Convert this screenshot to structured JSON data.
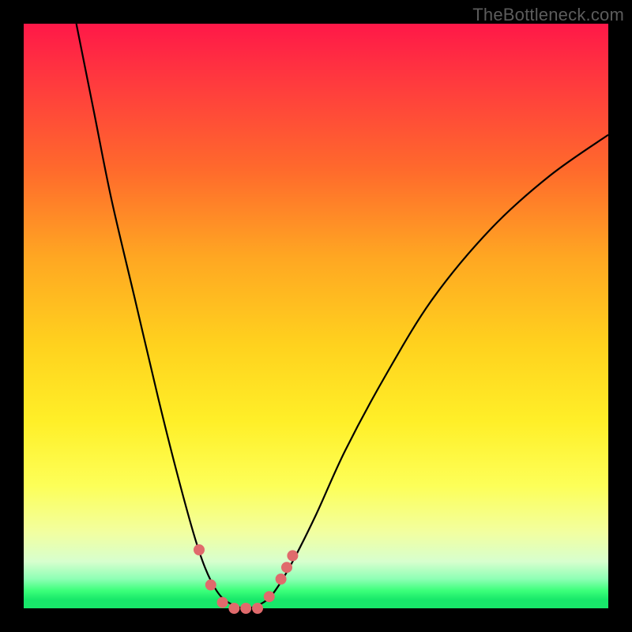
{
  "watermark": "TheBottleneck.com",
  "chart_data": {
    "type": "line",
    "title": "",
    "xlabel": "",
    "ylabel": "",
    "xlim": [
      0,
      100
    ],
    "ylim": [
      0,
      100
    ],
    "grid": false,
    "legend": false,
    "background_gradient": {
      "direction": "vertical",
      "stops": [
        {
          "pos": 0,
          "color": "#ff1848"
        },
        {
          "pos": 25,
          "color": "#ff6a2c"
        },
        {
          "pos": 55,
          "color": "#ffd21e"
        },
        {
          "pos": 80,
          "color": "#fdff58"
        },
        {
          "pos": 92,
          "color": "#d7ffce"
        },
        {
          "pos": 100,
          "color": "#18e86a"
        }
      ]
    },
    "series": [
      {
        "name": "bottleneck-curve",
        "points": [
          {
            "x": 9,
            "y": 100
          },
          {
            "x": 12,
            "y": 85
          },
          {
            "x": 15,
            "y": 70
          },
          {
            "x": 19,
            "y": 53
          },
          {
            "x": 23,
            "y": 36
          },
          {
            "x": 26,
            "y": 24
          },
          {
            "x": 29,
            "y": 13
          },
          {
            "x": 31,
            "y": 7
          },
          {
            "x": 33,
            "y": 3
          },
          {
            "x": 35,
            "y": 1
          },
          {
            "x": 38,
            "y": 0
          },
          {
            "x": 41,
            "y": 1
          },
          {
            "x": 43,
            "y": 3
          },
          {
            "x": 46,
            "y": 8
          },
          {
            "x": 50,
            "y": 16
          },
          {
            "x": 55,
            "y": 27
          },
          {
            "x": 62,
            "y": 40
          },
          {
            "x": 70,
            "y": 53
          },
          {
            "x": 80,
            "y": 65
          },
          {
            "x": 90,
            "y": 74
          },
          {
            "x": 100,
            "y": 81
          }
        ]
      }
    ],
    "markers": [
      {
        "x": 30,
        "y": 10
      },
      {
        "x": 32,
        "y": 4
      },
      {
        "x": 34,
        "y": 1
      },
      {
        "x": 36,
        "y": 0
      },
      {
        "x": 38,
        "y": 0
      },
      {
        "x": 40,
        "y": 0
      },
      {
        "x": 42,
        "y": 2
      },
      {
        "x": 44,
        "y": 5
      },
      {
        "x": 45,
        "y": 7
      },
      {
        "x": 46,
        "y": 9
      }
    ],
    "marker_color": "#e06a6c",
    "curve_color": "#000000"
  }
}
